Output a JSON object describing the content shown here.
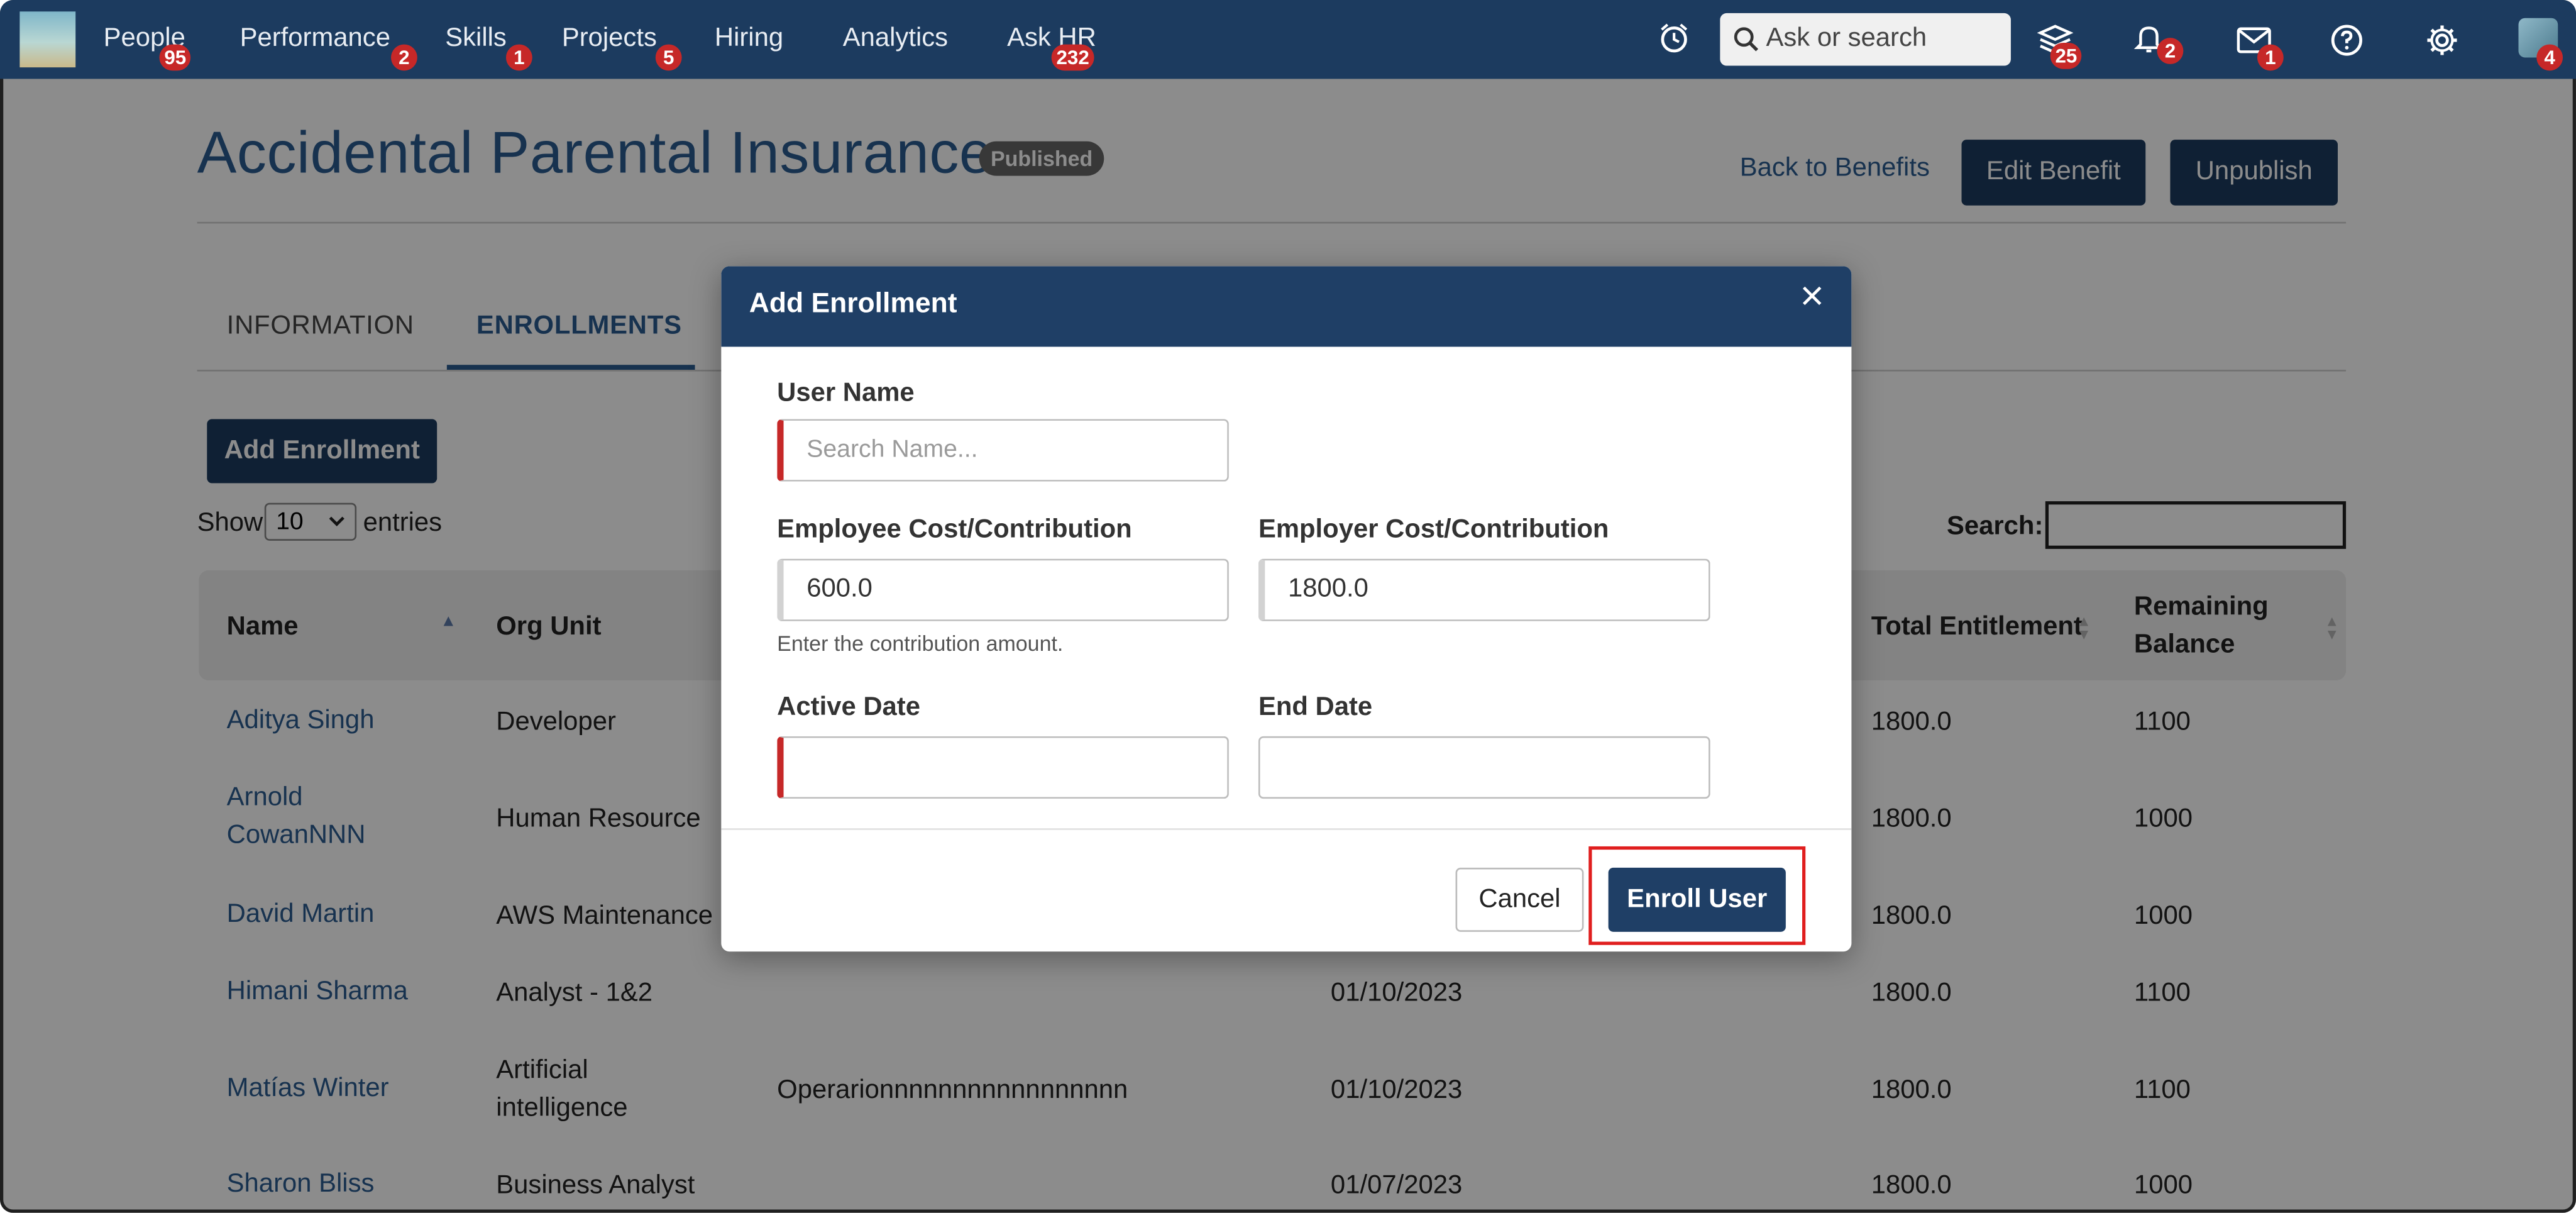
{
  "nav": {
    "items": [
      {
        "label": "People",
        "badge": "95"
      },
      {
        "label": "Performance",
        "badge": "2"
      },
      {
        "label": "Skills",
        "badge": "1"
      },
      {
        "label": "Projects",
        "badge": "5"
      },
      {
        "label": "Hiring",
        "badge": ""
      },
      {
        "label": "Analytics",
        "badge": ""
      },
      {
        "label": "Ask HR",
        "badge": "232"
      }
    ],
    "search_placeholder": "Ask or search",
    "icon_badges": {
      "learning": "25",
      "notifications": "2",
      "messages": "1",
      "avatar": "4"
    }
  },
  "page": {
    "title": "Accidental Parental Insurance",
    "status": "Published",
    "back_link": "Back to Benefits",
    "edit_button": "Edit Benefit",
    "unpublish_button": "Unpublish"
  },
  "tabs": [
    "INFORMATION",
    "ENROLLMENTS"
  ],
  "enrollments": {
    "add_button": "Add Enrollment",
    "show_label": "Show",
    "page_size": "10",
    "entries_label": "entries",
    "search_label": "Search:",
    "columns": [
      "Name",
      "Org Unit",
      "Total Entitlement",
      "Remaining Balance"
    ],
    "rows": [
      {
        "name": "Aditya Singh",
        "org": "Developer",
        "extra": "",
        "date": "",
        "total": "1800.0",
        "remaining": "1100"
      },
      {
        "name": "Arnold CowanNNN",
        "org": "Human Resource",
        "extra": "",
        "date": "",
        "total": "1800.0",
        "remaining": "1000"
      },
      {
        "name": "David Martin",
        "org": "AWS Maintenance",
        "extra": "",
        "date": "",
        "total": "1800.0",
        "remaining": "1000"
      },
      {
        "name": "Himani Sharma",
        "org": "Analyst - 1&2",
        "extra": "",
        "date": "01/10/2023",
        "total": "1800.0",
        "remaining": "1100"
      },
      {
        "name": "Matías Winter",
        "org": "Artificial intelligence",
        "extra": "Operarionnnnnnnnnnnnnnnnn",
        "date": "01/10/2023",
        "total": "1800.0",
        "remaining": "1100"
      },
      {
        "name": "Sharon Bliss",
        "org": "Business Analyst",
        "extra": "",
        "date": "01/07/2023",
        "total": "1800.0",
        "remaining": "1000"
      }
    ]
  },
  "modal": {
    "title": "Add Enrollment",
    "user_name_label": "User Name",
    "user_name_placeholder": "Search Name...",
    "employee_cost_label": "Employee Cost/Contribution",
    "employee_cost_value": "600.0",
    "employee_cost_help": "Enter the contribution amount.",
    "employer_cost_label": "Employer Cost/Contribution",
    "employer_cost_value": "1800.0",
    "active_date_label": "Active Date",
    "active_date_value": "",
    "end_date_label": "End Date",
    "end_date_value": "",
    "cancel_button": "Cancel",
    "enroll_button": "Enroll User"
  },
  "colors": {
    "nav_bg": "#1c3b5f",
    "accent": "#2a5b90",
    "required": "#c62828",
    "highlight": "#e01e1e"
  }
}
